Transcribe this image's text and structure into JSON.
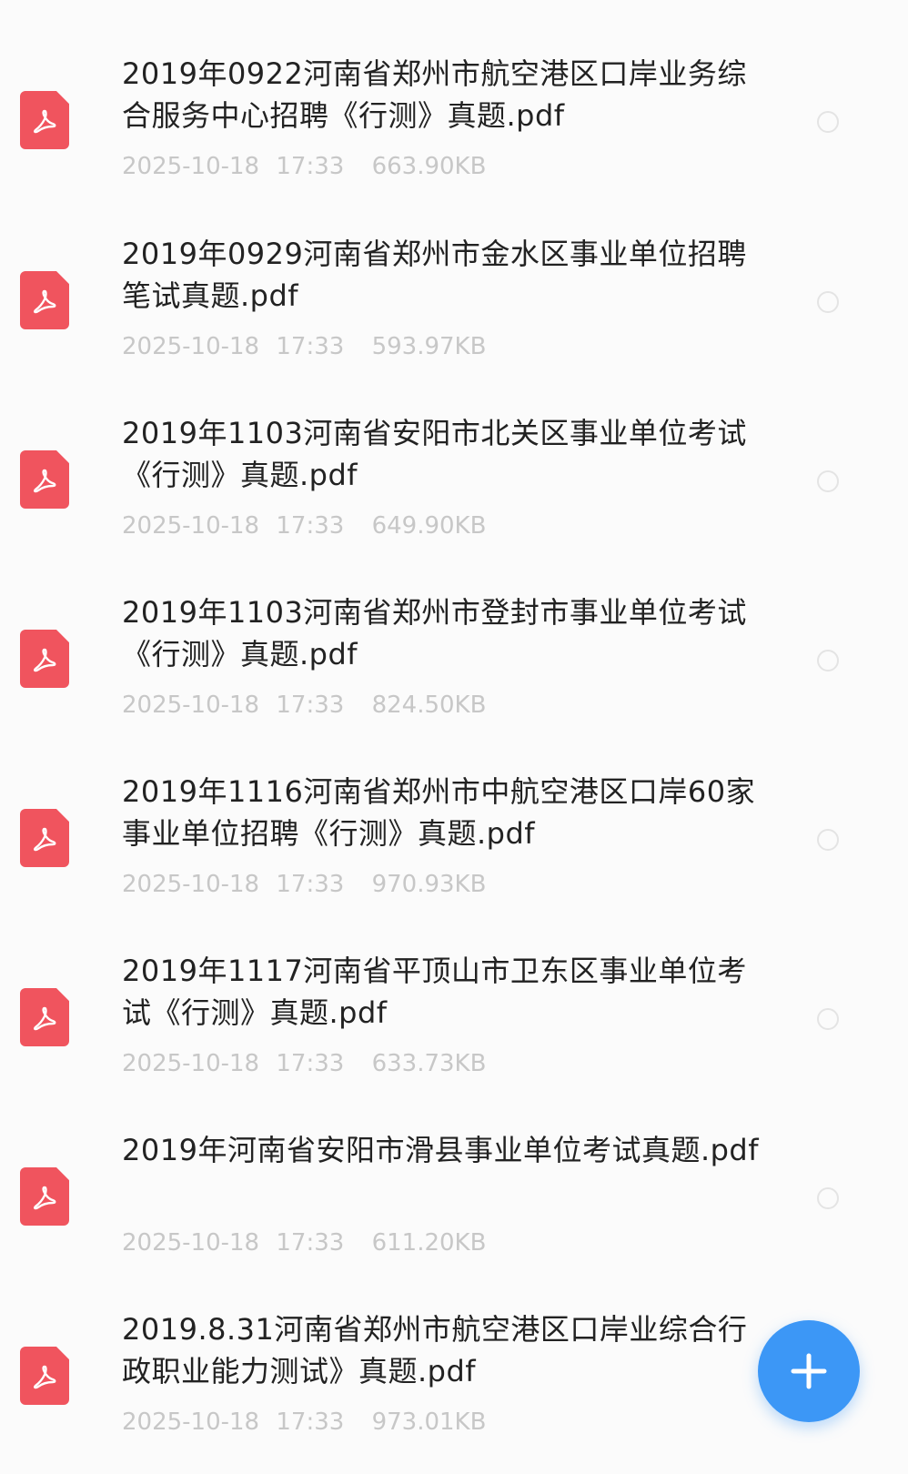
{
  "files": [
    {
      "name": "2019年0922河南省郑州市航空港区口岸业务综合服务中心招聘《行测》真题.pdf",
      "date": "2025-10-18",
      "time": "17:33",
      "size": "663.90KB",
      "icon": "pdf-icon"
    },
    {
      "name": "2019年0929河南省郑州市金水区事业单位招聘笔试真题.pdf",
      "date": "2025-10-18",
      "time": "17:33",
      "size": "593.97KB",
      "icon": "pdf-icon"
    },
    {
      "name": "2019年1103河南省安阳市北关区事业单位考试《行测》真题.pdf",
      "date": "2025-10-18",
      "time": "17:33",
      "size": "649.90KB",
      "icon": "pdf-icon"
    },
    {
      "name": "2019年1103河南省郑州市登封市事业单位考试《行测》真题.pdf",
      "date": "2025-10-18",
      "time": "17:33",
      "size": "824.50KB",
      "icon": "pdf-icon"
    },
    {
      "name": "2019年1116河南省郑州市中航空港区口岸60家事业单位招聘《行测》真题.pdf",
      "date": "2025-10-18",
      "time": "17:33",
      "size": "970.93KB",
      "icon": "pdf-icon"
    },
    {
      "name": "2019年1117河南省平顶山市卫东区事业单位考试《行测》真题.pdf",
      "date": "2025-10-18",
      "time": "17:33",
      "size": "633.73KB",
      "icon": "pdf-icon"
    },
    {
      "name": "2019年河南省安阳市滑县事业单位考试真题.pdf",
      "date": "2025-10-18",
      "time": "17:33",
      "size": "611.20KB",
      "icon": "pdf-icon"
    },
    {
      "name": "2019.8.31河南省郑州市航空港区口岸业综合行政职业能力测试》真题.pdf",
      "date": "2025-10-18",
      "time": "17:33",
      "size": "973.01KB",
      "icon": "pdf-icon"
    }
  ],
  "fab": {
    "icon": "plus-icon",
    "color": "#3c97f6"
  },
  "colors": {
    "pdf_icon": "#f0545e",
    "meta_text": "#c7c7c7",
    "name_text": "#222222"
  }
}
